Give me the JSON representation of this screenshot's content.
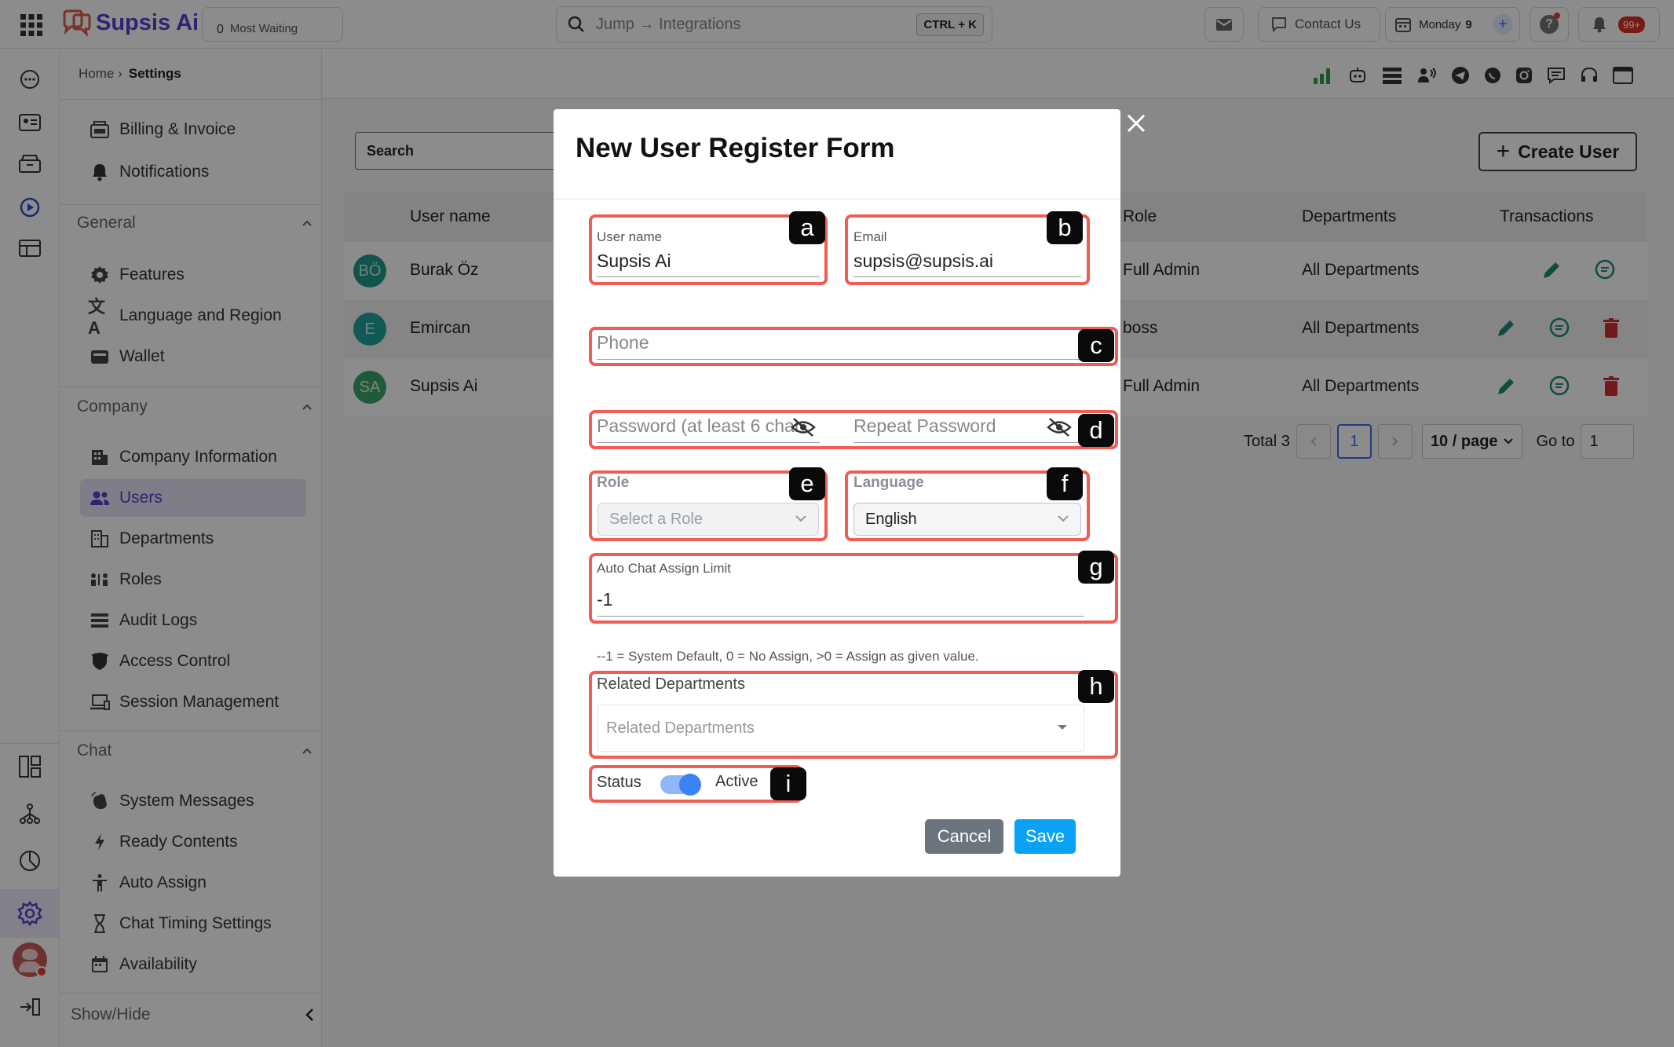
{
  "topbar": {
    "brand": "Supsis Ai",
    "waiting_count": "0",
    "waiting_label": "Most Waiting",
    "search_placeholder": "Jump → Integrations",
    "search_shortcut": "CTRL + K",
    "contact_label": "Contact Us",
    "day_label": "Monday",
    "day_number": "9",
    "notification_badge": "99+"
  },
  "breadcrumb": {
    "home": "Home ›",
    "current": "Settings"
  },
  "sidebar": {
    "top_items": [
      {
        "label": "Billing & Invoice",
        "icon": "billing-icon"
      },
      {
        "label": "Notifications",
        "icon": "bell-icon"
      }
    ],
    "general": {
      "title": "General",
      "items": [
        {
          "label": "Features",
          "icon": "gear-icon"
        },
        {
          "label": "Language and Region",
          "icon": "translate-icon"
        },
        {
          "label": "Wallet",
          "icon": "wallet-icon"
        }
      ]
    },
    "company": {
      "title": "Company",
      "items": [
        {
          "label": "Company Information",
          "icon": "building-icon"
        },
        {
          "label": "Users",
          "icon": "users-icon",
          "active": true
        },
        {
          "label": "Departments",
          "icon": "departments-icon"
        },
        {
          "label": "Roles",
          "icon": "roles-icon"
        },
        {
          "label": "Audit Logs",
          "icon": "list-icon"
        },
        {
          "label": "Access Control",
          "icon": "shield-icon"
        },
        {
          "label": "Session Management",
          "icon": "devices-icon"
        }
      ]
    },
    "chat": {
      "title": "Chat",
      "items": [
        {
          "label": "System Messages",
          "icon": "wave-icon"
        },
        {
          "label": "Ready Contents",
          "icon": "bolt-icon"
        },
        {
          "label": "Auto Assign",
          "icon": "person-icon"
        },
        {
          "label": "Chat Timing Settings",
          "icon": "hourglass-icon"
        },
        {
          "label": "Availability",
          "icon": "calendar-icon"
        }
      ]
    },
    "show_hide": "Show/Hide"
  },
  "users_page": {
    "search_placeholder": "Search",
    "create_user": "Create User",
    "columns": {
      "username": "User name",
      "role": "Role",
      "departments": "Departments",
      "transactions": "Transactions"
    },
    "rows": [
      {
        "initials": "BÖ",
        "name": "Burak Öz",
        "role": "Full Admin",
        "departments": "All Departments"
      },
      {
        "initials": "E",
        "name": "Emircan",
        "role": "boss",
        "departments": "All Departments"
      },
      {
        "initials": "SA",
        "name": "Supsis Ai",
        "role": "Full Admin",
        "departments": "All Departments"
      }
    ],
    "pagination": {
      "total": "Total 3",
      "page": "1",
      "page_size": "10 / page",
      "goto_label": "Go to",
      "goto_value": "1"
    }
  },
  "modal": {
    "title": "New User Register Form",
    "username": {
      "label": "User name",
      "value": "Supsis Ai"
    },
    "email": {
      "label": "Email",
      "value": "supsis@supsis.ai"
    },
    "phone": {
      "placeholder": "Phone"
    },
    "password": {
      "placeholder": "Password (at least 6 char"
    },
    "repeat_password": {
      "placeholder": "Repeat Password"
    },
    "role": {
      "label": "Role",
      "placeholder": "Select a Role"
    },
    "language": {
      "label": "Language",
      "value": "English"
    },
    "auto_chat": {
      "label": "Auto Chat Assign Limit",
      "value": "-1",
      "hint": "--1 = System Default, 0 = No Assign, >0 = Assign as given value."
    },
    "related_departments": {
      "label": "Related Departments",
      "placeholder": "Related Departments"
    },
    "status": {
      "label": "Status",
      "value": "Active",
      "on": true
    },
    "cancel": "Cancel",
    "save": "Save"
  },
  "annotations": [
    "a",
    "b",
    "c",
    "d",
    "e",
    "f",
    "g",
    "h",
    "i"
  ],
  "colors": {
    "accent": "#5b3fd1",
    "highlight": "#ef5d55",
    "save": "#0aa2f5",
    "cancel": "#6c757d",
    "toggle": "#3b82f6"
  }
}
